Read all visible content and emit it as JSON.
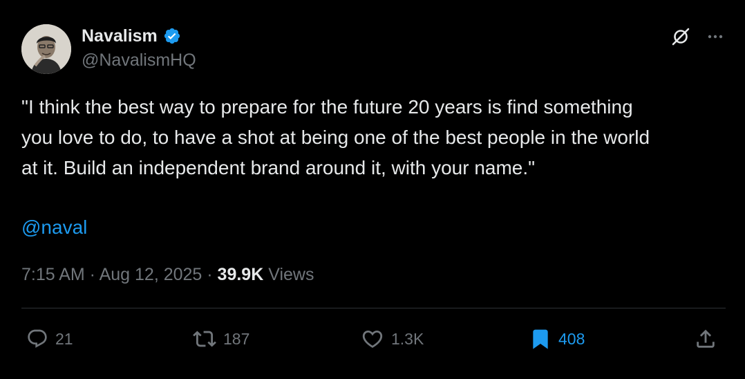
{
  "author": {
    "display_name": "Navalism",
    "handle": "@NavalismHQ",
    "avatar_icon": "author-avatar",
    "verified_color": "#1d9bf0"
  },
  "header_icons": {
    "grok_icon": "grok-icon",
    "more_icon": "more-icon"
  },
  "tweet": {
    "text": "\"I think the best way to prepare for the future 20 years is find something\nyou love to do, to have a shot at being one of the best people in the world\nat it. Build an independent brand around it, with your name.\"",
    "mention": "@naval"
  },
  "meta": {
    "time": "7:15 AM",
    "separator": " · ",
    "date": "Aug 12, 2025",
    "views_count": "39.9K",
    "views_label": "Views"
  },
  "actions": {
    "replies": "21",
    "reposts": "187",
    "likes": "1.3K",
    "bookmarks": "408",
    "bookmark_active_color": "#1d9bf0",
    "inactive_color": "#71767b"
  }
}
